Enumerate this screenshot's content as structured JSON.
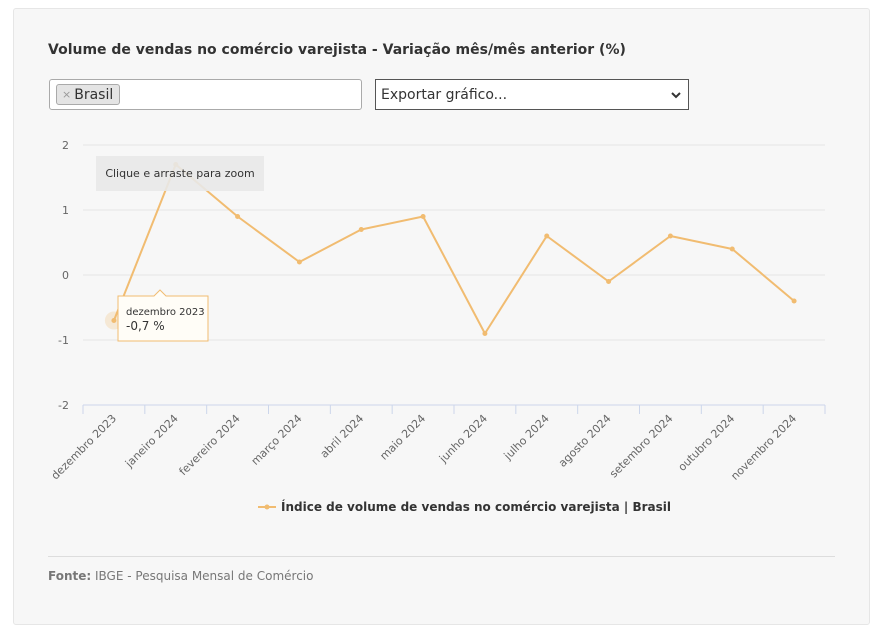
{
  "title": "Volume de vendas no comércio varejista - Variação mês/mês anterior (%)",
  "filter": {
    "chips": [
      "Brasil"
    ],
    "remove_glyph": "×"
  },
  "export": {
    "selected": "Exportar gráfico..."
  },
  "zoom_hint": "Clique e arraste para zoom",
  "tooltip": {
    "label": "dezembro 2023",
    "value": "-0,7 %"
  },
  "source": {
    "label": "Fonte:",
    "text": "IBGE - Pesquisa Mensal de Comércio"
  },
  "colors": {
    "series": "#f1bc71",
    "grid": "#e6e6e6",
    "axis": "#ccd6eb",
    "text": "#666666"
  },
  "chart_data": {
    "type": "line",
    "title": "Volume de vendas no comércio varejista - Variação mês/mês anterior (%)",
    "categories": [
      "dezembro 2023",
      "janeiro 2024",
      "fevereiro 2024",
      "março 2024",
      "abril 2024",
      "maio 2024",
      "junho 2024",
      "julho 2024",
      "agosto 2024",
      "setembro 2024",
      "outubro 2024",
      "novembro 2024"
    ],
    "series": [
      {
        "name": "Índice de volume de vendas no comércio varejista | Brasil",
        "values": [
          -0.7,
          1.7,
          0.9,
          0.2,
          0.7,
          0.9,
          -0.9,
          0.6,
          -0.1,
          0.6,
          0.4,
          -0.4
        ]
      }
    ],
    "yticks": [
      "2",
      "1",
      "0",
      "-1",
      "-2"
    ],
    "ylim": [
      -2,
      2
    ],
    "xlabel": "",
    "ylabel": "",
    "grid": true,
    "legend": "bottom-center"
  }
}
